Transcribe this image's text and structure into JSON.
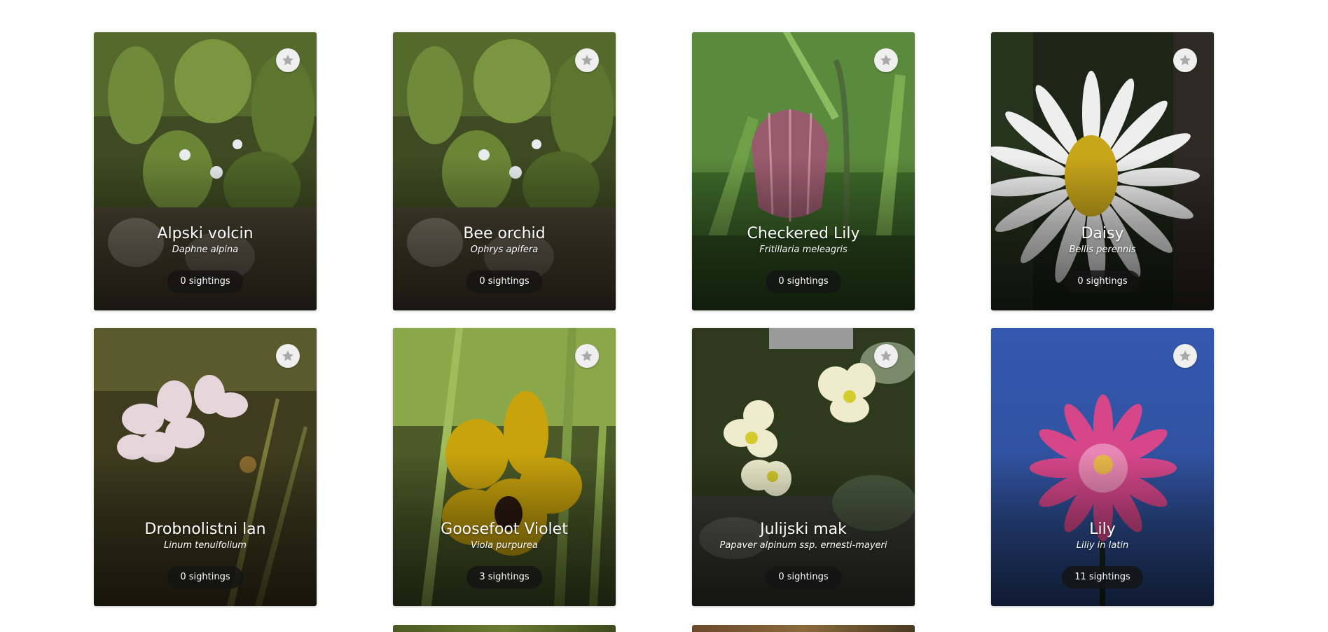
{
  "plants": [
    {
      "name": "Alpski volcin",
      "latin": "Daphne alpina",
      "sightings": "0 sightings",
      "favorite_icon": "star-icon"
    },
    {
      "name": "Bee orchid",
      "latin": "Ophrys apifera",
      "sightings": "0 sightings",
      "favorite_icon": "star-icon"
    },
    {
      "name": "Checkered Lily",
      "latin": "Fritillaria meleagris",
      "sightings": "0 sightings",
      "favorite_icon": "star-icon"
    },
    {
      "name": "Daisy",
      "latin": "Bellis perennis",
      "sightings": "0 sightings",
      "favorite_icon": "star-icon"
    },
    {
      "name": "Drobnolistni lan",
      "latin": "Linum tenuifolium",
      "sightings": "0 sightings",
      "favorite_icon": "star-icon"
    },
    {
      "name": "Goosefoot Violet",
      "latin": "Viola purpurea",
      "sightings": "3 sightings",
      "favorite_icon": "star-icon"
    },
    {
      "name": "Julijski mak",
      "latin": "Papaver alpinum ssp. ernesti-mayeri",
      "sightings": "0 sightings",
      "favorite_icon": "star-icon"
    },
    {
      "name": "Lily",
      "latin": "Liliy in latin",
      "sightings": "11 sightings",
      "favorite_icon": "star-icon"
    }
  ],
  "colors": {
    "badge_bg": "#141414",
    "fav_bg": "#efefef",
    "star": "#a9a9a9"
  }
}
